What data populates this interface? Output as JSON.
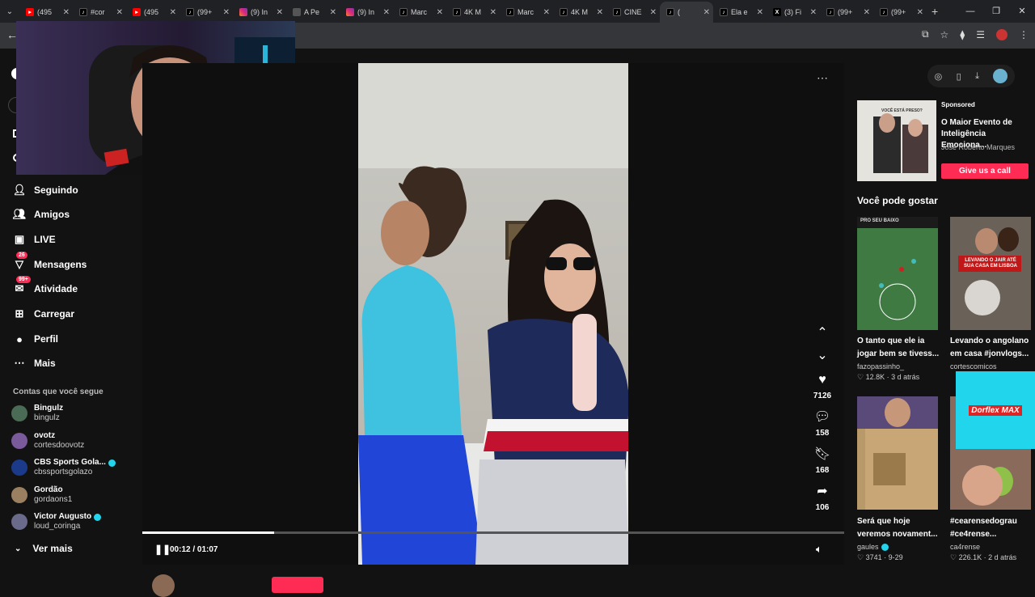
{
  "browser": {
    "tabs": [
      {
        "title": "(495",
        "icon": "youtube"
      },
      {
        "title": "#cor",
        "icon": "tiktok"
      },
      {
        "title": "(495",
        "icon": "youtube"
      },
      {
        "title": "(99+",
        "icon": "tiktok"
      },
      {
        "title": "(9) In",
        "icon": "instagram"
      },
      {
        "title": "A Pe",
        "icon": "document"
      },
      {
        "title": "(9) In",
        "icon": "instagram"
      },
      {
        "title": "Marc",
        "icon": "tiktok"
      },
      {
        "title": "4K M",
        "icon": "tiktok"
      },
      {
        "title": "Marc",
        "icon": "tiktok"
      },
      {
        "title": "4K M",
        "icon": "tiktok"
      },
      {
        "title": "CINE",
        "icon": "tiktok"
      },
      {
        "title": "(",
        "icon": "tiktok",
        "active": true
      },
      {
        "title": "Ela e",
        "icon": "tiktok"
      },
      {
        "title": "(3) Fi",
        "icon": "x"
      },
      {
        "title": "(99+",
        "icon": "tiktok"
      },
      {
        "title": "(99+",
        "icon": "tiktok"
      }
    ]
  },
  "sidebar": {
    "items": [
      {
        "label": "Seguindo",
        "icon": "following-icon"
      },
      {
        "label": "Amigos",
        "icon": "friends-icon"
      },
      {
        "label": "LIVE",
        "icon": "live-icon"
      },
      {
        "label": "Mensagens",
        "icon": "messages-icon",
        "badge": "26"
      },
      {
        "label": "Atividade",
        "icon": "activity-icon",
        "badge": "99+"
      },
      {
        "label": "Carregar",
        "icon": "upload-icon"
      },
      {
        "label": "Perfil",
        "icon": "profile-icon"
      },
      {
        "label": "Mais",
        "icon": "more-icon"
      }
    ],
    "following_title": "Contas que você segue",
    "accounts": [
      {
        "name": "Bingulz",
        "handle": "bingulz",
        "verified": false,
        "color": "#4a6b55"
      },
      {
        "name": "ovotz",
        "handle": "cortesdoovotz",
        "verified": false,
        "color": "#7a5a9a"
      },
      {
        "name": "CBS Sports Gola...",
        "handle": "cbssportsgolazo",
        "verified": true,
        "color": "#1c3a8a"
      },
      {
        "name": "Gordão",
        "handle": "gordaons1",
        "verified": false,
        "color": "#9a8060"
      },
      {
        "name": "Victor Augusto",
        "handle": "loud_coringa",
        "verified": true,
        "color": "#6a6a8a"
      }
    ],
    "see_more": "Ver mais"
  },
  "player": {
    "time": "00:12 / 01:07",
    "progress": 0.188,
    "likes": "7126",
    "comments": "158",
    "saves": "168",
    "shares": "106"
  },
  "right_panel": {
    "sponsored_label": "Sponsored",
    "ad_title": "O Maior Evento de Inteligência Emociona...",
    "ad_author": "José Roberto Marques",
    "ad_cta": "Give us a call",
    "ad_thumb_text": "VOCÊ ESTÁ PRESO?",
    "section_title": "Você pode gostar",
    "videos": [
      {
        "title": "O tanto que ele ia jogar bem se tivess...",
        "author": "fazopassinho_",
        "stats": "♡ 12.8K · 3 d atrás",
        "verified": false
      },
      {
        "title": "Levando o angolano em casa #jonvlogs...",
        "author": "cortescomicos",
        "stats": "",
        "verified": false
      },
      {
        "title": "Será que hoje veremos novament...",
        "author": "gaules",
        "stats": "♡ 3741 · 9-29",
        "verified": true
      },
      {
        "title": "#cearensedograu #ce4rense...",
        "author": "ca4rense",
        "stats": "♡ 226.1K · 2 d atrás",
        "verified": false
      }
    ],
    "thumb_texts": {
      "t1": "PRO SEU BAIXO",
      "t2": "LEVANDO O JAIR ATÉ SUA CASA EM LISBOA"
    },
    "overlay_ad": "Dorflex MAX"
  },
  "colors": {
    "accent": "#fe2c55",
    "verified": "#20d5ec"
  }
}
